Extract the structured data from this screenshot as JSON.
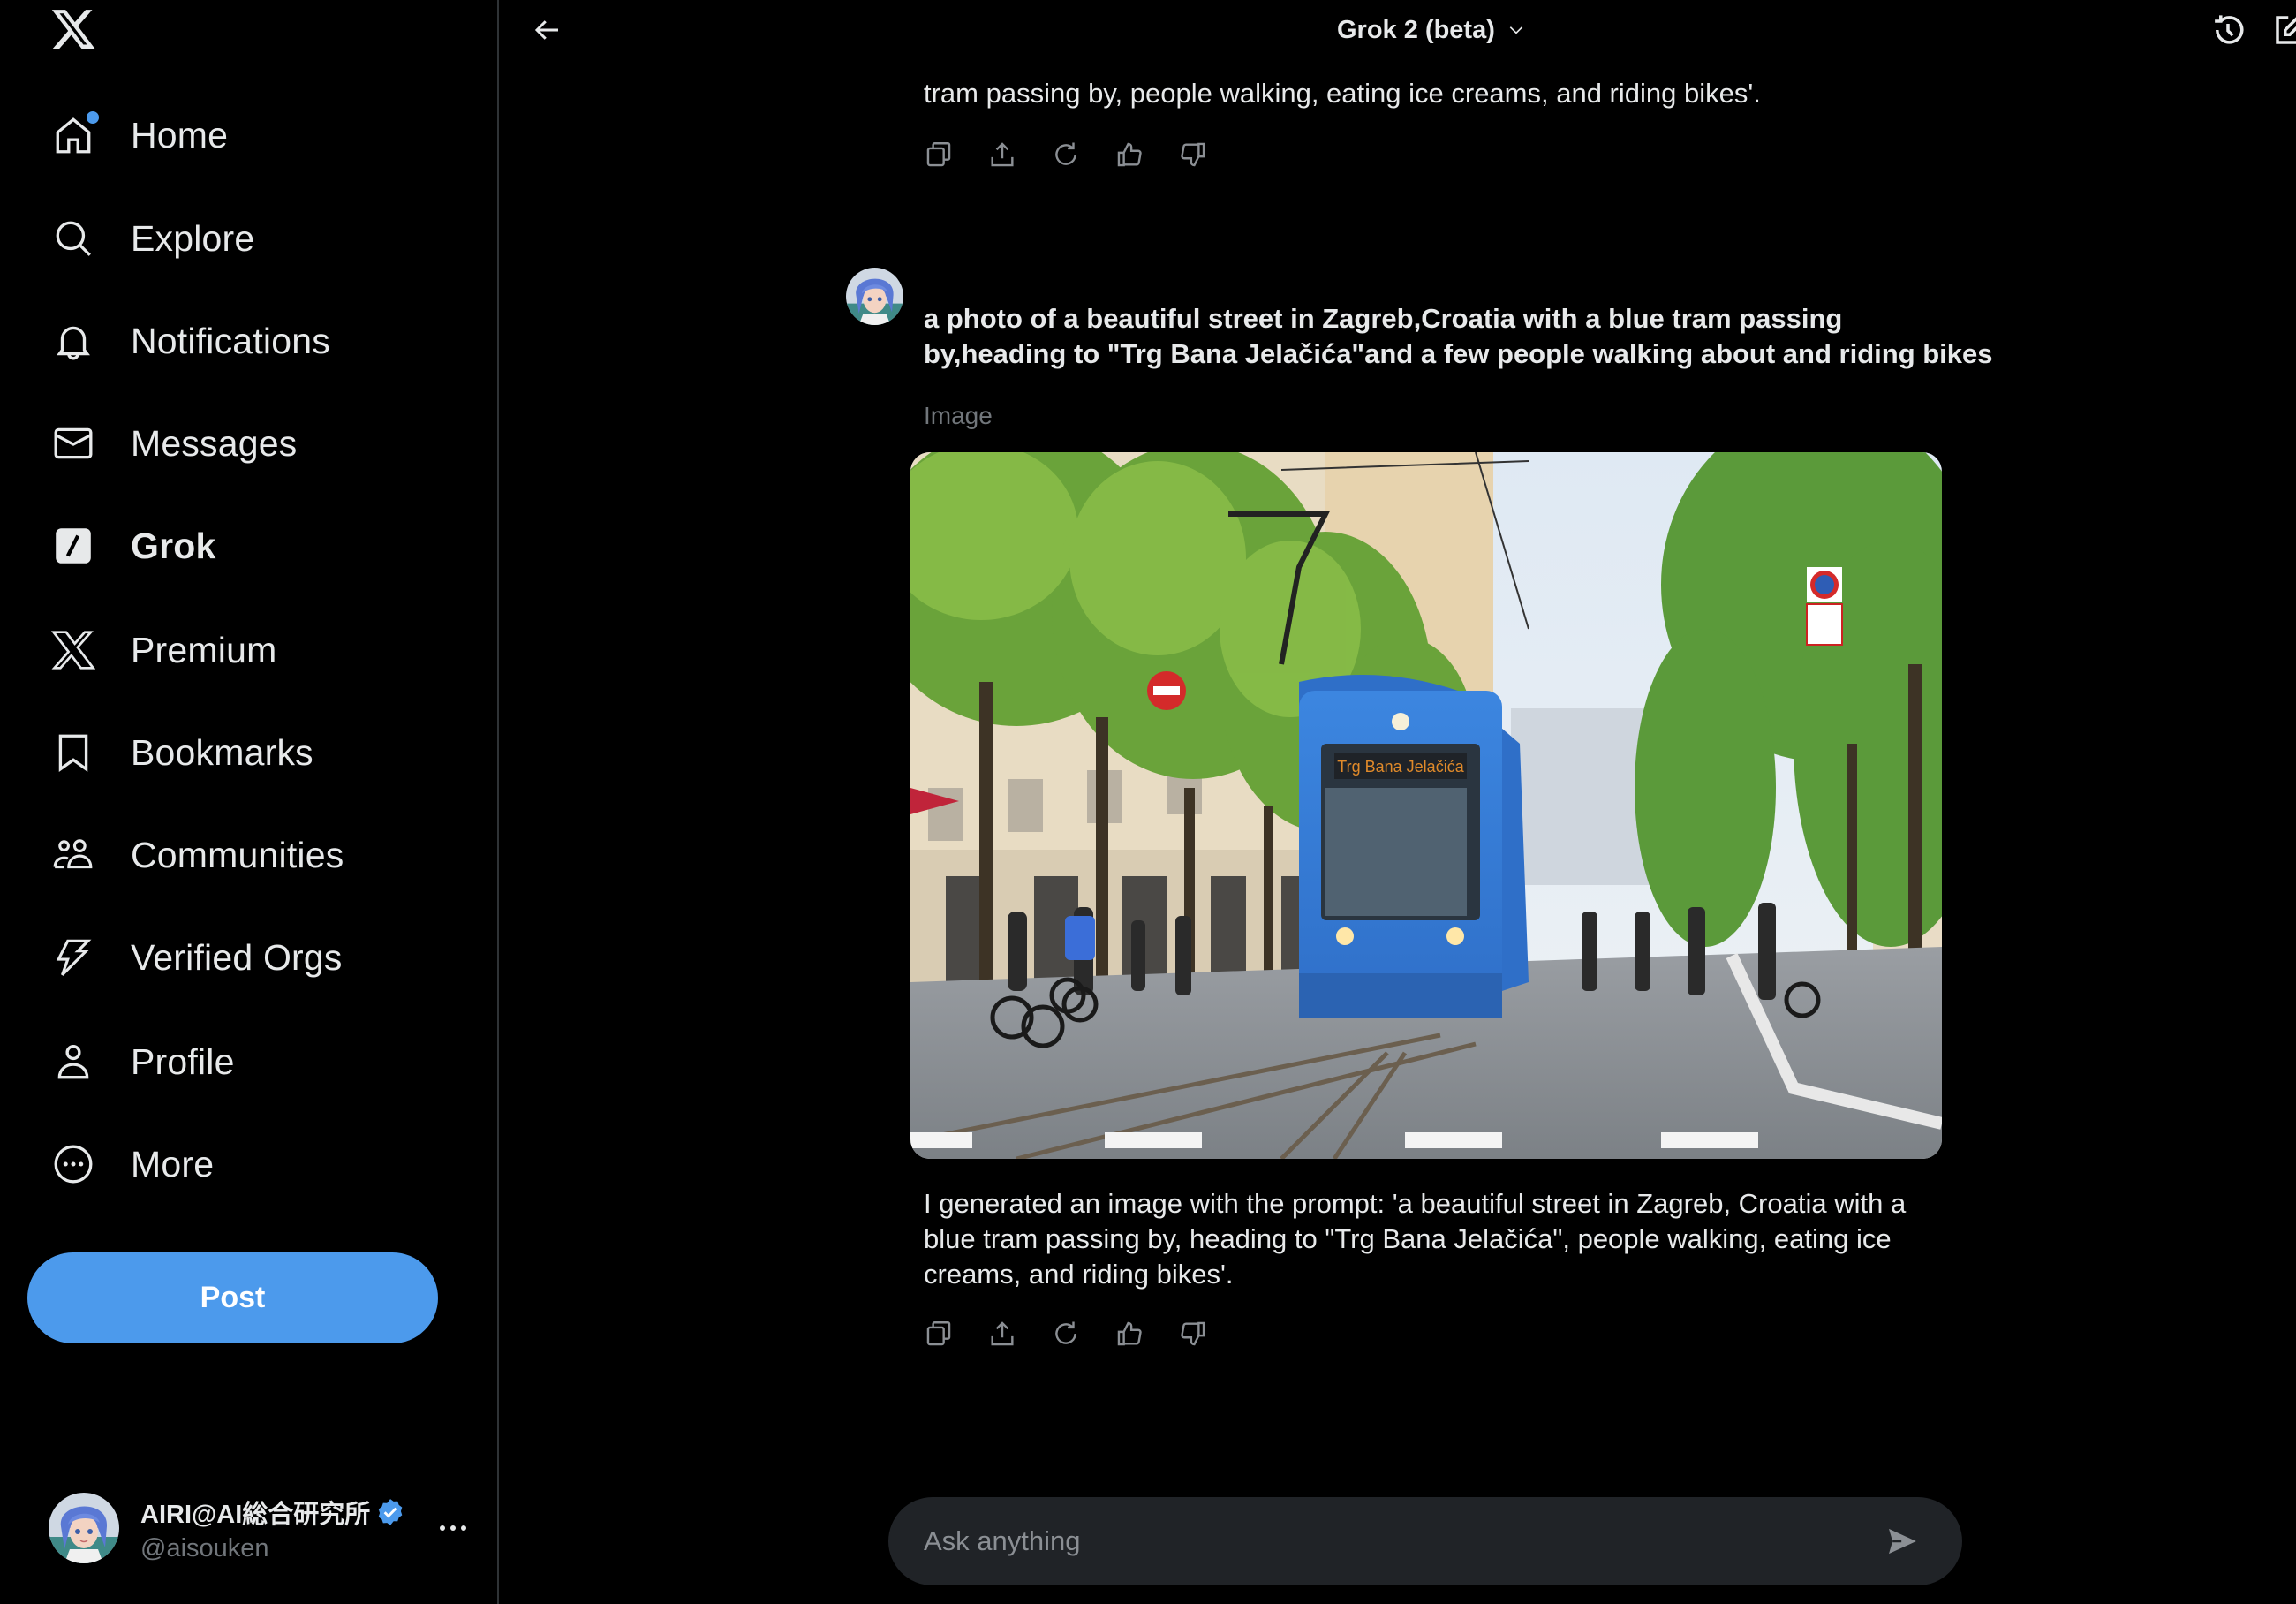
{
  "app": {
    "name": "X",
    "logo_icon": "x-logo-icon"
  },
  "sidebar": {
    "items": [
      {
        "label": "Home",
        "icon": "home-icon",
        "has_notification_dot": true,
        "active": false
      },
      {
        "label": "Explore",
        "icon": "search-icon",
        "active": false
      },
      {
        "label": "Notifications",
        "icon": "bell-icon",
        "active": false
      },
      {
        "label": "Messages",
        "icon": "envelope-icon",
        "active": false
      },
      {
        "label": "Grok",
        "icon": "grok-icon",
        "active": true
      },
      {
        "label": "Premium",
        "icon": "x-premium-icon",
        "active": false
      },
      {
        "label": "Bookmarks",
        "icon": "bookmark-icon",
        "active": false
      },
      {
        "label": "Communities",
        "icon": "communities-icon",
        "active": false
      },
      {
        "label": "Verified Orgs",
        "icon": "lightning-icon",
        "active": false
      },
      {
        "label": "Profile",
        "icon": "person-icon",
        "active": false
      },
      {
        "label": "More",
        "icon": "more-circle-icon",
        "active": false
      }
    ],
    "post_button": "Post",
    "account": {
      "name": "AIRI@AI総合研究所",
      "handle": "@aisouken",
      "verified": true
    }
  },
  "header": {
    "title": "Grok 2 (beta)",
    "back_icon": "arrow-left-icon",
    "history_icon": "history-icon",
    "new_chat_icon": "compose-icon"
  },
  "chat": {
    "previous_response_tail": "tram passing by, people walking, eating ice creams, and riding bikes'.",
    "user_message": {
      "lines": [
        "a photo of a beautiful street in Zagreb,Croatia  with a blue tram passing",
        "by,heading to \"Trg Bana Jelačića\"and a few people walking about and riding bikes"
      ]
    },
    "response": {
      "type_label": "Image",
      "image_alt": "Generated image of a blue tram on a tree-lined street in Zagreb with pedestrians and cyclists",
      "tram_destination_sign": "Trg Bana Jelačića",
      "lines": [
        "I generated an image with the prompt: 'a beautiful street in Zagreb, Croatia with a",
        "blue tram passing by, heading to \"Trg Bana Jelačića\", people walking, eating ice",
        "creams, and riding bikes'."
      ]
    },
    "actions": [
      {
        "name": "copy",
        "icon": "copy-icon"
      },
      {
        "name": "share",
        "icon": "share-icon"
      },
      {
        "name": "regenerate",
        "icon": "refresh-icon"
      },
      {
        "name": "like",
        "icon": "thumbs-up-icon"
      },
      {
        "name": "dislike",
        "icon": "thumbs-down-icon"
      }
    ]
  },
  "composer": {
    "placeholder": "Ask anything",
    "value": "",
    "send_icon": "send-icon"
  },
  "colors": {
    "accent": "#4c9aec",
    "background": "#000000",
    "input_bg": "#202327",
    "muted_text": "#71767b",
    "divider": "#2f3336"
  }
}
